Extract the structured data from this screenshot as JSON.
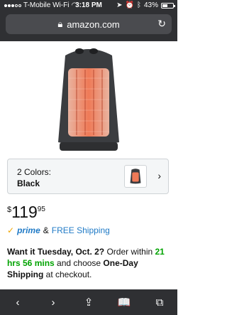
{
  "status_bar": {
    "carrier": "T-Mobile Wi-Fi",
    "time": "3:18 PM",
    "battery": "43%"
  },
  "browser": {
    "url": "amazon.com"
  },
  "product": {
    "image_icon": "space-heater-image"
  },
  "colors": {
    "count_label": "2 Colors:",
    "selected": "Black"
  },
  "price": {
    "currency": "$",
    "dollars": "119",
    "cents": "95"
  },
  "prime": {
    "check": "✓",
    "label": "prime",
    "amp": "&",
    "shipping": "FREE Shipping"
  },
  "delivery": {
    "part1": "Want it Tuesday, Oct. 2?",
    "part2": " Order within ",
    "countdown": "21 hrs 56 mins",
    "part3": " and choose ",
    "method": "One-Day Shipping",
    "part4": " at checkout."
  },
  "bottom_nav": {
    "back": "‹",
    "forward": "›",
    "share": "⇪",
    "bookmarks": "📖",
    "tabs": "⧉"
  }
}
